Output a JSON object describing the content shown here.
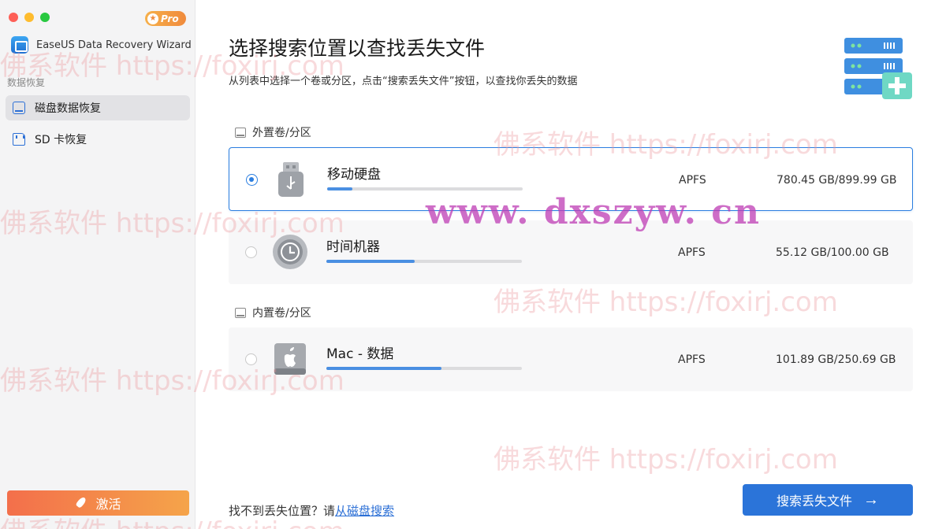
{
  "sidebar": {
    "pro_badge": "Pro",
    "app_title": "EaseUS Data Recovery Wizard",
    "section_label": "数据恢复",
    "items": [
      {
        "label": "磁盘数据恢复",
        "active": true,
        "icon": "disk-icon"
      },
      {
        "label": "SD 卡恢复",
        "active": false,
        "icon": "sd-card-icon"
      }
    ],
    "activate_label": "激活"
  },
  "main": {
    "title": "选择搜索位置以查找丢失文件",
    "subtitle": "从列表中选择一个卷或分区，点击“搜索丢失文件”按钮，以查找你丢失的数据",
    "external_group_label": "外置卷/分区",
    "internal_group_label": "内置卷/分区",
    "drives": [
      {
        "name": "移动硬盘",
        "fs": "APFS",
        "size": "780.45 GB/899.99 GB",
        "used_fraction": 0.13,
        "selected": true,
        "icon": "usb-drive-icon"
      },
      {
        "name": "时间机器",
        "fs": "APFS",
        "size": "55.12 GB/100.00 GB",
        "used_fraction": 0.45,
        "selected": false,
        "icon": "time-machine-icon"
      },
      {
        "name": "Mac - 数据",
        "fs": "APFS",
        "size": "101.89 GB/250.69 GB",
        "used_fraction": 0.59,
        "selected": false,
        "icon": "mac-disk-icon"
      }
    ],
    "footer_prefix": "找不到丢失位置？请",
    "footer_link": "从磁盘搜索",
    "search_button": "搜索丢失文件"
  },
  "watermark": {
    "text": "佛系软件 https://foxirj.com",
    "center": "www. dxszyw. cn"
  },
  "colors": {
    "accent": "#2b74d9",
    "activate_start": "#f36f4b",
    "activate_end": "#f5a44a"
  }
}
